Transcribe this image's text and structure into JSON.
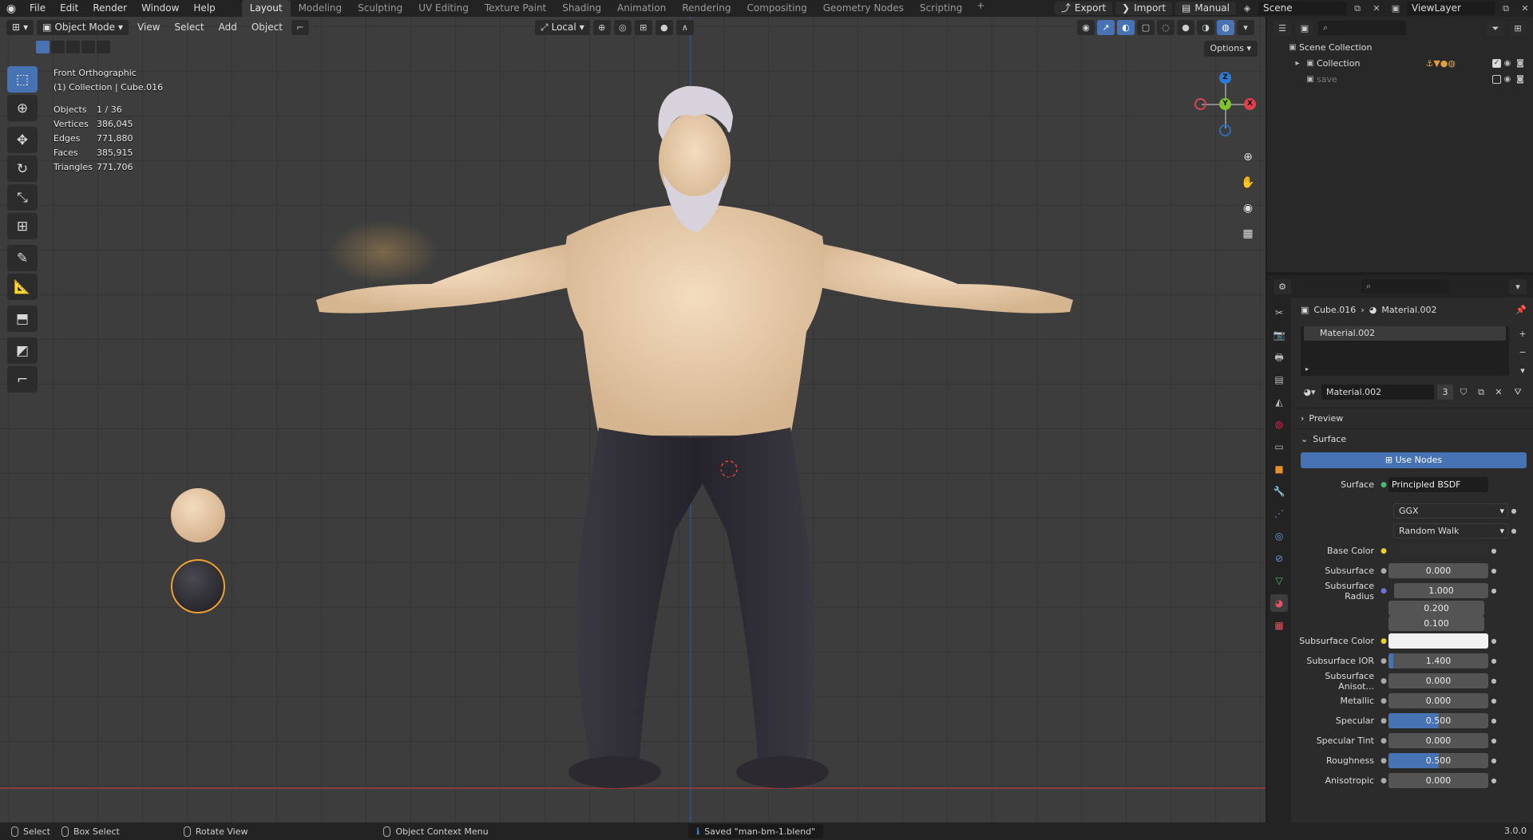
{
  "topbar": {
    "menus": [
      "File",
      "Edit",
      "Render",
      "Window",
      "Help"
    ],
    "workspaces": [
      "Layout",
      "Modeling",
      "Sculpting",
      "UV Editing",
      "Texture Paint",
      "Shading",
      "Animation",
      "Rendering",
      "Compositing",
      "Geometry Nodes",
      "Scripting"
    ],
    "add_tab": "+",
    "export_label": "Export",
    "import_label": "Import",
    "manual_label": "Manual",
    "scene": "Scene",
    "view_layer": "ViewLayer"
  },
  "viewport": {
    "mode": "Object Mode",
    "menus": [
      "View",
      "Select",
      "Add",
      "Object"
    ],
    "transform_orientation": "Local",
    "options_label": "Options",
    "view_name": "Front Orthographic",
    "context": "(1) Collection | Cube.016",
    "stats": [
      {
        "label": "Objects",
        "value": "1 / 36"
      },
      {
        "label": "Vertices",
        "value": "386,045"
      },
      {
        "label": "Edges",
        "value": "771,880"
      },
      {
        "label": "Faces",
        "value": "385,915"
      },
      {
        "label": "Triangles",
        "value": "771,706"
      }
    ],
    "gizmo": {
      "z": "Z",
      "y": "Y",
      "x": "X"
    }
  },
  "outliner": {
    "search_placeholder": "",
    "scene_collection": "Scene Collection",
    "collection": "Collection",
    "save": "save"
  },
  "properties": {
    "object_name": "Cube.016",
    "material_name": "Material.002",
    "slot_name": "Material.002",
    "material_users": "3",
    "preview_label": "Preview",
    "surface_label": "Surface",
    "use_nodes_label": "Use Nodes",
    "surface_shader_label": "Surface",
    "surface_shader": "Principled BSDF",
    "distribution": "GGX",
    "subsurface_method": "Random Walk",
    "rows": {
      "base_color": "Base Color",
      "subsurface": {
        "label": "Subsurface",
        "value": "0.000"
      },
      "subsurface_radius": {
        "label": "Subsurface Radius",
        "values": [
          "1.000",
          "0.200",
          "0.100"
        ]
      },
      "subsurface_color": "Subsurface Color",
      "subsurface_ior": {
        "label": "Subsurface IOR",
        "value": "1.400",
        "fill": 0.05
      },
      "subsurface_aniso": {
        "label": "Subsurface Anisot...",
        "value": "0.000"
      },
      "metallic": {
        "label": "Metallic",
        "value": "0.000"
      },
      "specular": {
        "label": "Specular",
        "value": "0.500",
        "fill": 0.5
      },
      "specular_tint": {
        "label": "Specular Tint",
        "value": "0.000"
      },
      "roughness": {
        "label": "Roughness",
        "value": "0.500",
        "fill": 0.5
      },
      "anisotropic": {
        "label": "Anisotropic",
        "value": "0.000"
      }
    },
    "colors": {
      "accent": "#4772b3",
      "base_color": "#2d2d2d",
      "subsurface_color": "#f2f2f2"
    }
  },
  "statusbar": {
    "select": "Select",
    "box_select": "Box Select",
    "rotate_view": "Rotate View",
    "context_menu": "Object Context Menu",
    "saved_message": "Saved \"man-bm-1.blend\"",
    "version": "3.0.0"
  }
}
